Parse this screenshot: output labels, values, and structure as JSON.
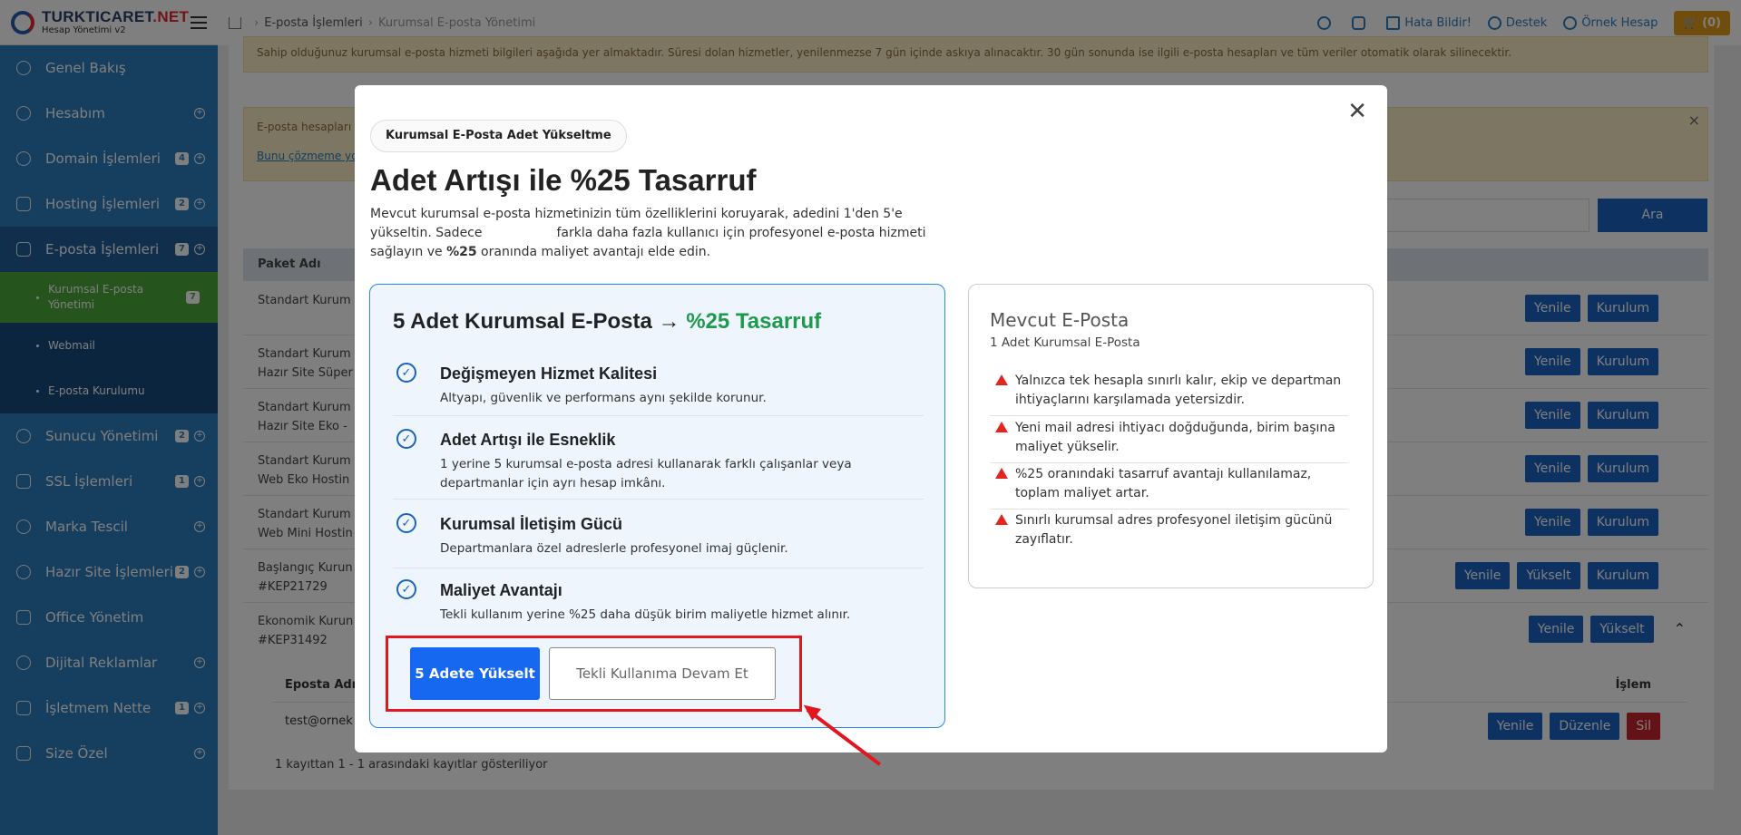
{
  "brand": {
    "name_part1": "TURKTICARET",
    "name_part2": ".NET",
    "subtitle": "Hesap Yönetimi v2"
  },
  "sidebar": {
    "items": [
      {
        "label": "Genel Bakış",
        "badge": "",
        "plus": false
      },
      {
        "label": "Hesabım",
        "badge": "",
        "plus": true
      },
      {
        "label": "Domain İşlemleri",
        "badge": "4",
        "plus": true
      },
      {
        "label": "Hosting İşlemleri",
        "badge": "2",
        "plus": true
      },
      {
        "label": "E-posta İşlemleri",
        "badge": "7",
        "plus": true
      },
      {
        "label": "Sunucu Yönetimi",
        "badge": "2",
        "plus": true
      },
      {
        "label": "SSL İşlemleri",
        "badge": "1",
        "plus": true
      },
      {
        "label": "Marka Tescil",
        "badge": "",
        "plus": true
      },
      {
        "label": "Hazır Site İşlemleri",
        "badge": "2",
        "plus": true
      },
      {
        "label": "Office Yönetim",
        "badge": "",
        "plus": false
      },
      {
        "label": "Dijital Reklamlar",
        "badge": "",
        "plus": true
      },
      {
        "label": "İşletmem Nette",
        "badge": "1",
        "plus": true
      },
      {
        "label": "Size Özel",
        "badge": "",
        "plus": true
      }
    ],
    "subitems": [
      {
        "label": "Kurumsal E-posta Yönetimi",
        "badge": "7"
      },
      {
        "label": "Webmail",
        "badge": ""
      },
      {
        "label": "E-posta Kurulumu",
        "badge": ""
      }
    ]
  },
  "topbar": {
    "crumb1": "E-posta İşlemleri",
    "crumb2": "Kurumsal E-posta Yönetimi",
    "report": "Hata Bildir!",
    "support": "Destek",
    "account": "Örnek Hesap",
    "cart": "(0)"
  },
  "page": {
    "notice": "Sahip olduğunuz kurumsal e-posta hizmeti bilgileri aşağıda yer almaktadır. Süresi dolan hizmetler, yenilenmezse 7 gün içinde askıya alınacaktır. 30 gün sonunda ise ilgili e-posta hesapları ve tüm veriler otomatik olarak silinecektir.",
    "notice2": "E-posta hesapları",
    "notice2_link": "Bunu çözmeme yo",
    "search_btn": "Ara",
    "col_package": "Paket Adı",
    "rows": [
      {
        "l1": "Standart Kurum",
        "l2": ""
      },
      {
        "l1": "Standart Kurum",
        "l2": "Hazır Site Süper"
      },
      {
        "l1": "Standart Kurum",
        "l2": "Hazır Site Eko -"
      },
      {
        "l1": "Standart Kurum",
        "l2": "Web Eko Hostin"
      },
      {
        "l1": "Standart Kurum",
        "l2": "Web Mini Hostin"
      },
      {
        "l1": "Başlangıç Kurun",
        "l2": "#KEP21729"
      },
      {
        "l1": "Ekonomik Kurun",
        "l2": "#KEP31492"
      }
    ],
    "btn_renew": "Yenile",
    "btn_setup": "Kurulum",
    "btn_upgrade": "Yükselt",
    "btn_edit": "Düzenle",
    "btn_delete": "Sil",
    "sub_col_email": "Eposta Adr",
    "sub_col_action": "İşlem",
    "sub_email": "test@ornek",
    "footer_info": "1 kayıttan 1 - 1 arasındaki kayıtlar gösteriliyor"
  },
  "modal": {
    "pill": "Kurumsal E-Posta Adet Yükseltme",
    "title": "Adet Artışı ile %25 Tasarruf",
    "desc1": "Mevcut kurumsal e-posta hizmetinizin tüm özelliklerini koruyarak, adedini 1'den 5'e yükseltin. Sadece",
    "desc2": "farkla daha fazla kullanıcı için profesyonel e-posta hizmeti sağlayın ve",
    "desc_bold": "%25",
    "desc3": "oranında maliyet avantajı elde edin.",
    "left_title": "5 Adet Kurumsal E-Posta →",
    "left_title_green": "%25 Tasarruf",
    "features": [
      {
        "title": "Değişmeyen Hizmet Kalitesi",
        "desc": "Altyapı, güvenlik ve performans aynı şekilde korunur."
      },
      {
        "title": "Adet Artışı ile Esneklik",
        "desc": "1 yerine 5 kurumsal e-posta adresi kullanarak farklı çalışanlar veya departmanlar için ayrı hesap imkânı."
      },
      {
        "title": "Kurumsal İletişim Gücü",
        "desc": "Departmanlara özel adreslerle profesyonel imaj güçlenir."
      },
      {
        "title": "Maliyet Avantajı",
        "desc": "Tekli kullanım yerine %25 daha düşük birim maliyetle hizmet alınır."
      }
    ],
    "btn_primary": "5 Adete Yükselt",
    "btn_secondary": "Tekli Kullanıma Devam Et",
    "right_title": "Mevcut E-Posta",
    "right_sub": "1 Adet Kurumsal E-Posta",
    "warnings": [
      "Yalnızca tek hesapla sınırlı kalır, ekip ve departman ihtiyaçlarını karşılamada yetersizdir.",
      "Yeni mail adresi ihtiyacı doğduğunda, birim başına maliyet yükselir.",
      "%25 oranındaki tasarruf avantajı kullanılamaz, toplam maliyet artar.",
      "Sınırlı kurumsal adres profesyonel iletişim gücünü zayıflatır."
    ]
  }
}
